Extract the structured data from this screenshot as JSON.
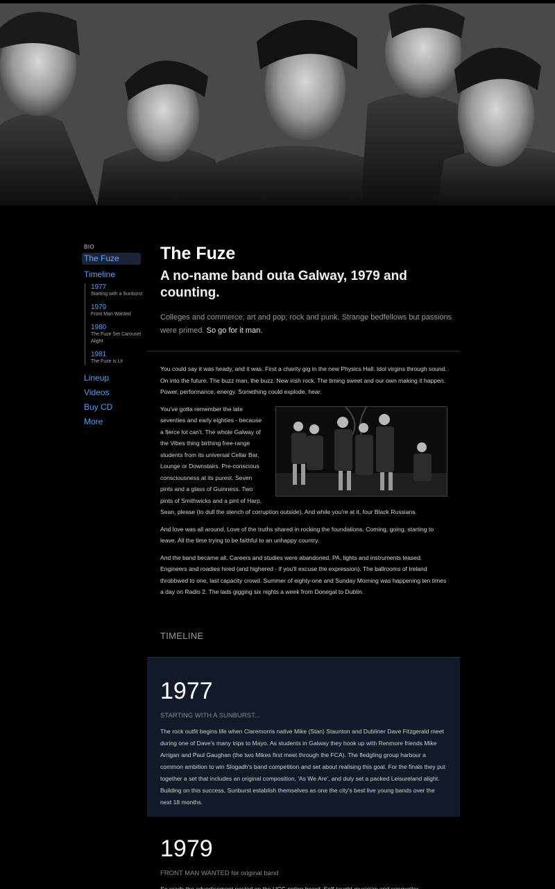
{
  "sidebar": {
    "heading": "BIO",
    "active_item": "The Fuze",
    "timeline_label": "Timeline",
    "timeline_items": [
      {
        "year": "1977",
        "desc": "Starting with a Sunburst"
      },
      {
        "year": "1979",
        "desc": "Front Man Wanted"
      },
      {
        "year": "1980",
        "desc": "The Fuze Set Carousel Alight"
      },
      {
        "year": "1981",
        "desc": "The Fuze is Lit"
      }
    ],
    "items": [
      "Lineup",
      "Videos",
      "Buy CD",
      "More"
    ]
  },
  "main": {
    "title": "The Fuze",
    "subtitle": "A no-name band outa Galway, 1979 and counting.",
    "intro": "Colleges and commerce; art and pop; rock and punk. Strange bedfellows but passions were primed.",
    "intro_emphasis": "So go for it man.",
    "paragraphs": [
      "You could say it was heady, and it was. First a charity gig in the new Physics Hall. Idol virgins through sound. On into the future. The buzz man, the buzz. New irish rock. The timing sweet and our own making it happen. Power, performance, energy. Something could explode, hear.",
      "You've gotta remember the late seventies and early eighties - because a fierce lot can't. The whole Galway of the Vibes thing birthing free-range students from its universal Cellar Bar, Lounge or Downstairs. Pre-conscious consciousness at its purest. Seven pints and a glass of Guinness. Two pints of Smithwicks and a pint of Harp, Sean, please (to dull the stench of corruption outside). And while you're at it, four Black Russians.",
      "And love was all around. Love of the truths shared in rocking the foundations. Coming, going, starting to leave. All the time trying to be faithful to an unhappy country.",
      "And the band became all. Careers and studies were abandoned. PA, lights and instruments leased. Engineers and roadies hired (and highered - if you'll excuse the expression). The ballrooms of Ireland throbbwed to one, last capacity crowd. Summer of eighty-one and Sunday Morning was happening ten times a day on Radio 2. The lads gigging six nights a week from Donegal to Dublin."
    ]
  },
  "timeline": {
    "heading": "TIMELINE",
    "entries": [
      {
        "year": "1977",
        "caption": "STARTING WITH A SUNBURST...",
        "text": "The rock outfit begins life when Claremorris native Mike (Stan) Staunton and Dubliner Dave Fitzgerald meet during one of Dave's many trips to Mayo. As students in Galway they hook up with Renmore friends Mike Arrigan and Paul Gaughan (the two Mikes first meet through the FCA). The fledgling group harbour a common ambition to win Slogadh's band competition and set about realising this goal. For the finals they put together a set that includes an original composition, 'As We Are', and duly set a packed Leisureland alight. Building on this success, Sunburst establish themselves as one the city's best live young bands over the next 18 months."
      },
      {
        "year": "1979",
        "caption": "FRONT MAN WANTED for original band",
        "text": "So reads the advertisement posted on the UCG notice board. Self-taught musician and songwriter"
      }
    ]
  },
  "colors": {
    "background": "#000000",
    "link": "#5a9cf0",
    "card": "#121a2a"
  }
}
